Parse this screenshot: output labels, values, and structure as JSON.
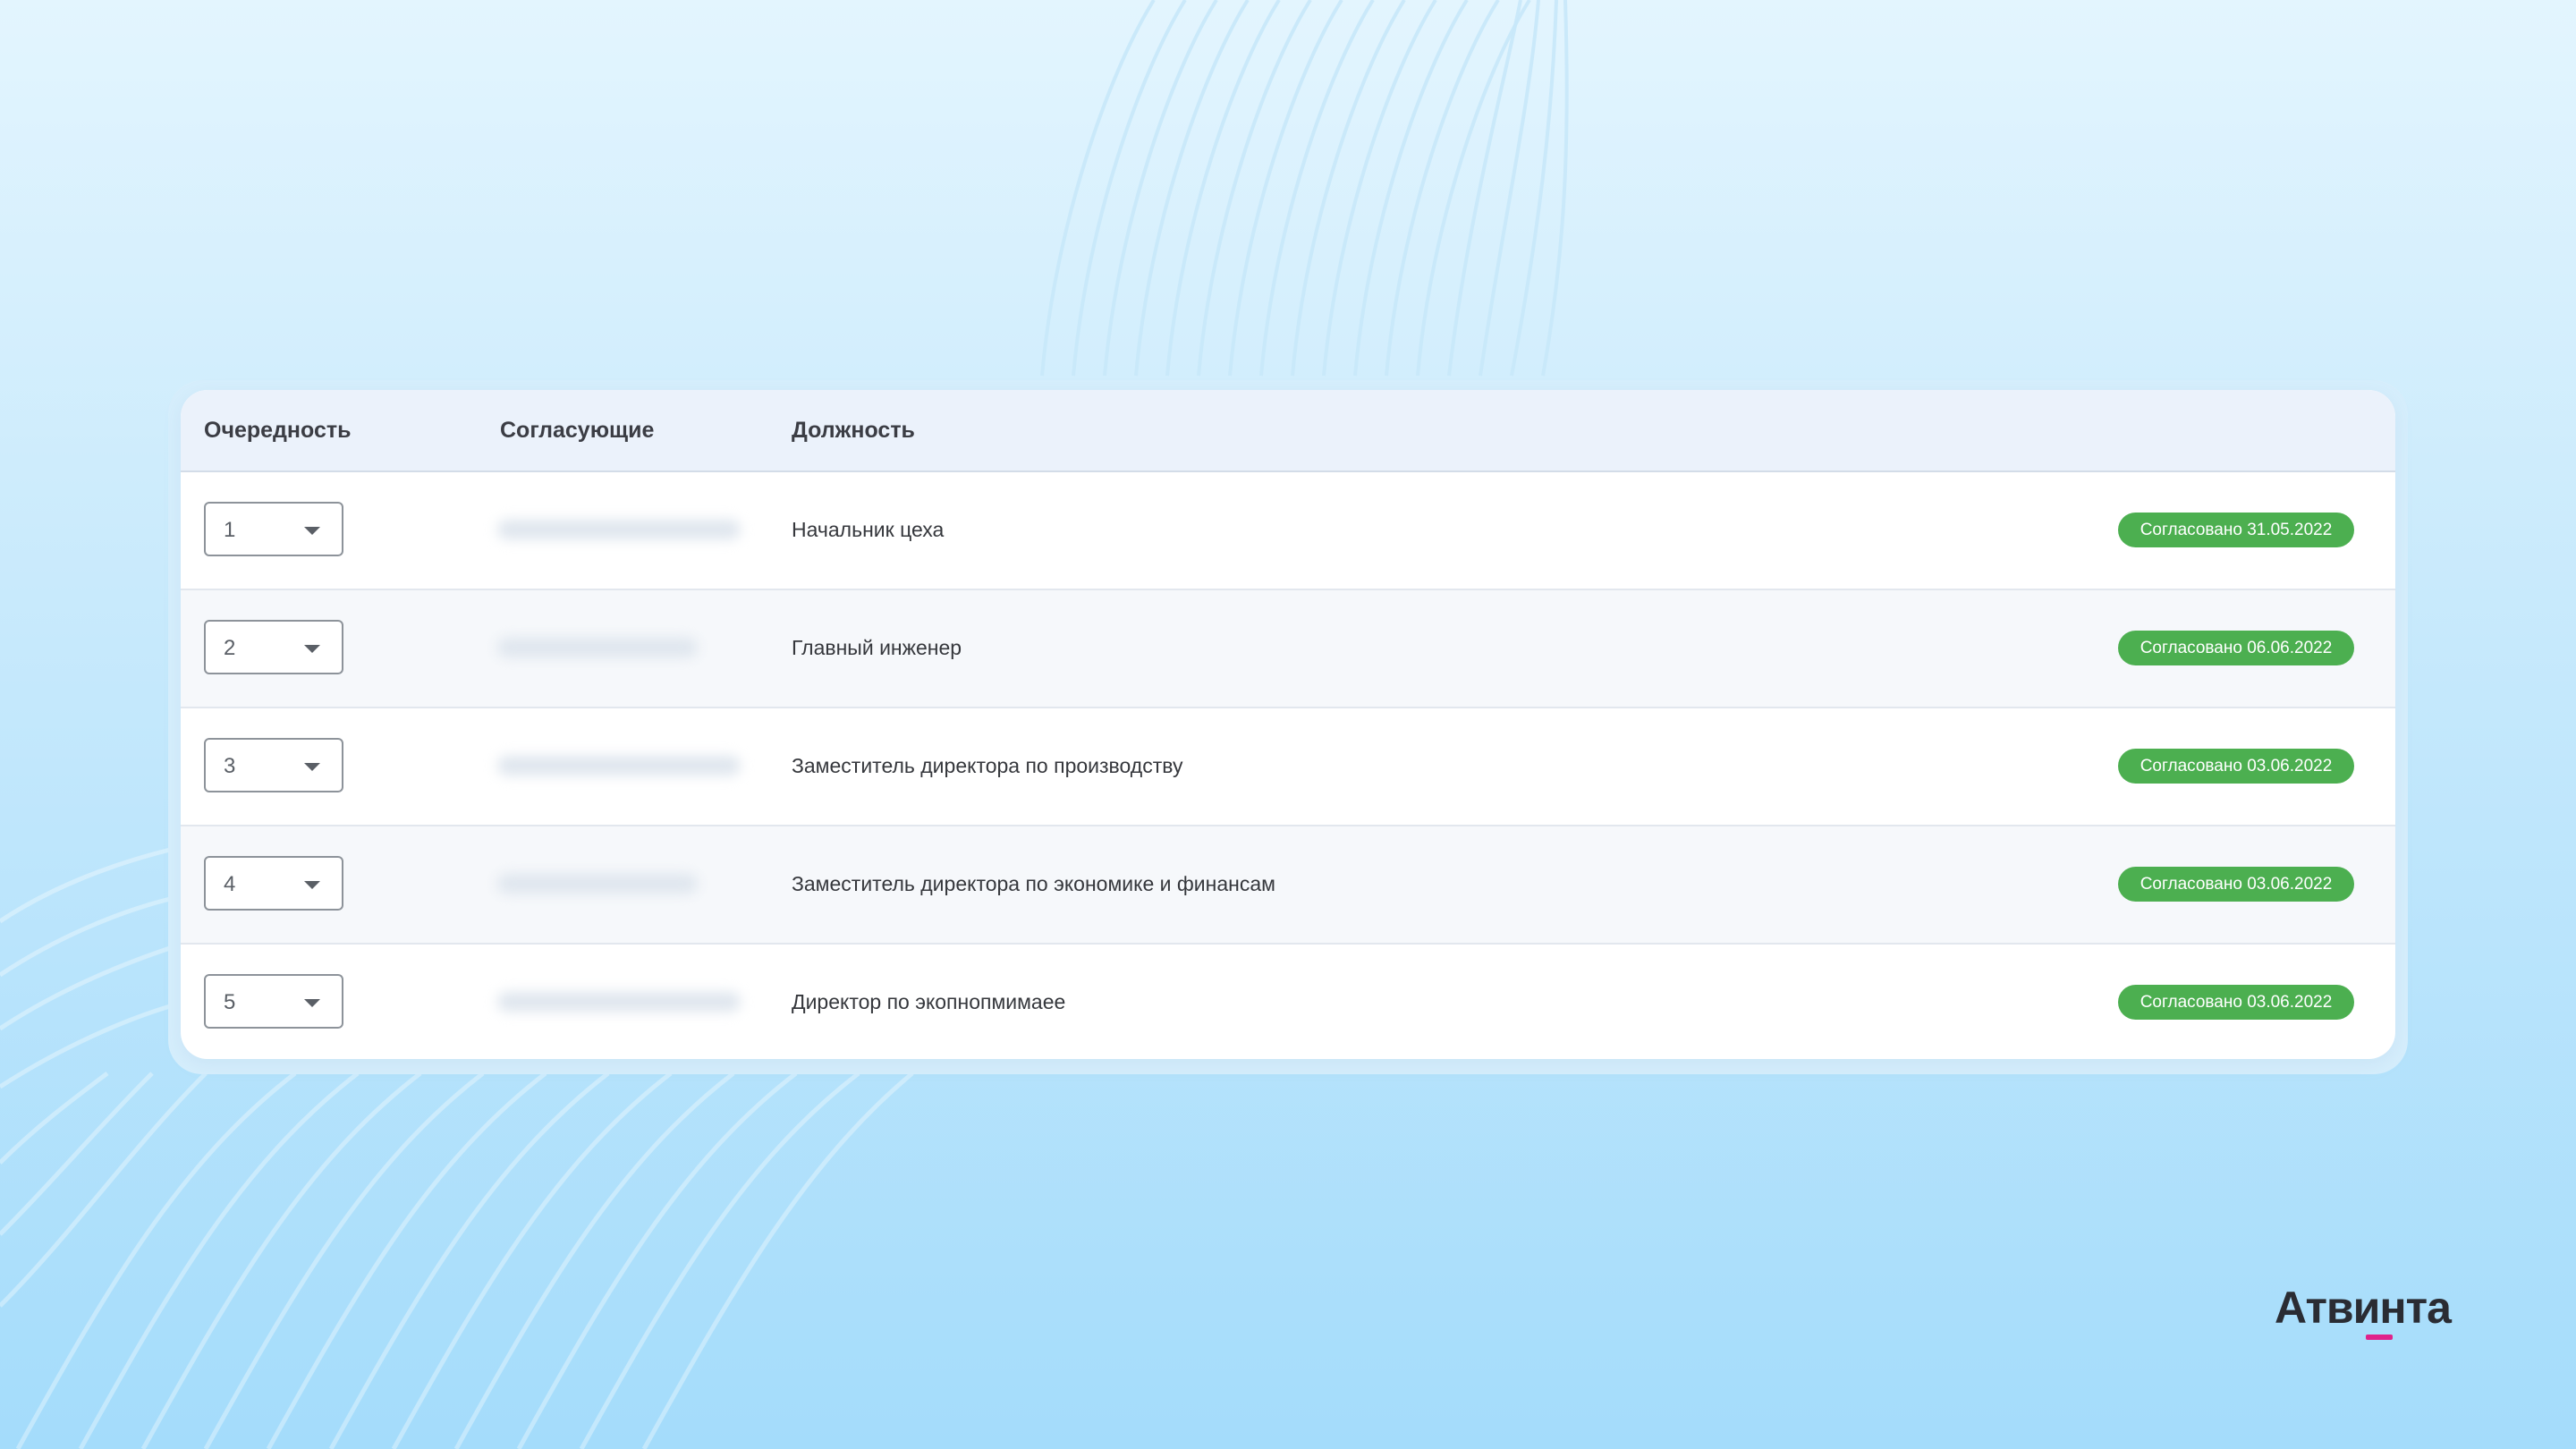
{
  "table": {
    "headers": {
      "order": "Очередность",
      "approvers": "Согласующие",
      "position": "Должность"
    },
    "rows": [
      {
        "order": "1",
        "position": "Начальник цеха",
        "status": "Согласовано 31.05.2022"
      },
      {
        "order": "2",
        "position": "Главный инженер",
        "status": "Согласовано 06.06.2022"
      },
      {
        "order": "3",
        "position": "Заместитель директора по производству",
        "status": "Согласовано 03.06.2022"
      },
      {
        "order": "4",
        "position": "Заместитель директора по экономике и финансам",
        "status": "Согласовано 03.06.2022"
      },
      {
        "order": "5",
        "position": "Директор по экопнопмимаее",
        "status": "Согласовано 03.06.2022"
      }
    ]
  },
  "brand": {
    "name": "Атвинта",
    "accent": "#e0228a"
  },
  "colors": {
    "status_approved": "#4caf50"
  },
  "icons": {
    "dropdown": "chevron-down-icon"
  }
}
